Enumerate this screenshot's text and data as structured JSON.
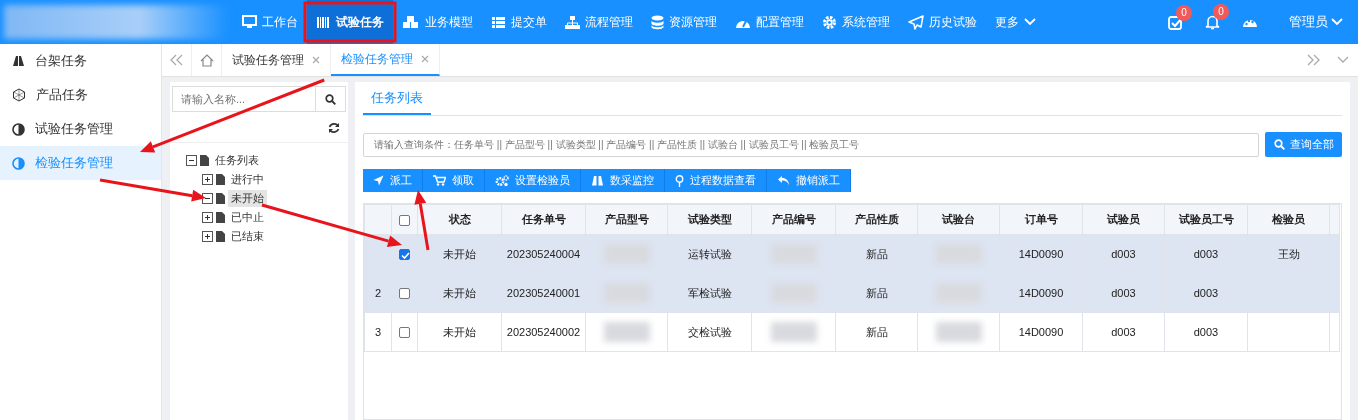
{
  "top_nav": {
    "items": [
      {
        "label": "工作台",
        "selected": false
      },
      {
        "label": "试验任务",
        "selected": true
      },
      {
        "label": "业务模型",
        "selected": false
      },
      {
        "label": "提交单",
        "selected": false
      },
      {
        "label": "流程管理",
        "selected": false
      },
      {
        "label": "资源管理",
        "selected": false
      },
      {
        "label": "配置管理",
        "selected": false
      },
      {
        "label": "系统管理",
        "selected": false
      },
      {
        "label": "历史试验",
        "selected": false
      },
      {
        "label": "更多",
        "selected": false
      }
    ],
    "notifications": [
      {
        "count": "0"
      },
      {
        "count": "0"
      }
    ],
    "user": "管理员"
  },
  "sidebar": {
    "items": [
      {
        "label": "台架任务",
        "selected": false
      },
      {
        "label": "产品任务",
        "selected": false
      },
      {
        "label": "试验任务管理",
        "selected": false
      },
      {
        "label": "检验任务管理",
        "selected": true
      }
    ]
  },
  "tabs": [
    {
      "label": "试验任务管理",
      "selected": false
    },
    {
      "label": "检验任务管理",
      "selected": true
    }
  ],
  "tree_panel": {
    "search": {
      "placeholder": "请输入名称..."
    },
    "tree": [
      {
        "label": "任务列表",
        "selected": false,
        "expanded": true,
        "children": [
          {
            "label": "进行中",
            "selected": false,
            "expanded": false
          },
          {
            "label": "未开始",
            "selected": true,
            "expanded": true
          },
          {
            "label": "已中止",
            "selected": false,
            "expanded": false
          },
          {
            "label": "已结束",
            "selected": false,
            "expanded": false
          }
        ]
      }
    ]
  },
  "main_panel": {
    "tab": "任务列表",
    "search": {
      "placeholder": "请输入查询条件：任务单号 || 产品型号 || 试验类型 || 产品编号 || 产品性质 || 试验台 || 试验员工号 || 检验员工号"
    },
    "query_button": "查询全部",
    "toolbar": [
      "派工",
      "领取",
      "设置检验员",
      "数采监控",
      "过程数据查看",
      "撤销派工"
    ],
    "table": {
      "all_checked": false,
      "columns": [
        "状态",
        "任务单号",
        "产品型号",
        "试验类型",
        "产品编号",
        "产品性质",
        "试验台",
        "订单号",
        "试验员",
        "试验员工号",
        "检验员"
      ],
      "rows": [
        {
          "checked": true,
          "highlighted": true,
          "cells": [
            {
              "kind": "text",
              "text": "未开始"
            },
            {
              "kind": "text",
              "text": "202305240004"
            },
            {
              "kind": "redacted"
            },
            {
              "kind": "text",
              "text": "运转试验"
            },
            {
              "kind": "redacted"
            },
            {
              "kind": "text",
              "text": "新品"
            },
            {
              "kind": "redacted"
            },
            {
              "kind": "text",
              "text": "14D0090"
            },
            {
              "kind": "text",
              "text": "d003"
            },
            {
              "kind": "text",
              "text": "d003"
            },
            {
              "kind": "text",
              "text": "王劲"
            }
          ]
        },
        {
          "number": "2",
          "checked": false,
          "highlighted": true,
          "cells": [
            {
              "kind": "text",
              "text": "未开始"
            },
            {
              "kind": "text",
              "text": "202305240001"
            },
            {
              "kind": "redacted"
            },
            {
              "kind": "text",
              "text": "军检试验"
            },
            {
              "kind": "redacted"
            },
            {
              "kind": "text",
              "text": "新品"
            },
            {
              "kind": "redacted"
            },
            {
              "kind": "text",
              "text": "14D0090"
            },
            {
              "kind": "text",
              "text": "d003"
            },
            {
              "kind": "text",
              "text": "d003"
            },
            {
              "kind": "empty"
            }
          ]
        },
        {
          "number": "3",
          "checked": false,
          "highlighted": false,
          "cells": [
            {
              "kind": "text",
              "text": "未开始"
            },
            {
              "kind": "text",
              "text": "202305240002"
            },
            {
              "kind": "redacted"
            },
            {
              "kind": "text",
              "text": "交检试验"
            },
            {
              "kind": "redacted"
            },
            {
              "kind": "text",
              "text": "新品"
            },
            {
              "kind": "redacted"
            },
            {
              "kind": "text",
              "text": "14D0090"
            },
            {
              "kind": "text",
              "text": "d003"
            },
            {
              "kind": "text",
              "text": "d003"
            },
            {
              "kind": "empty"
            }
          ]
        }
      ]
    }
  }
}
